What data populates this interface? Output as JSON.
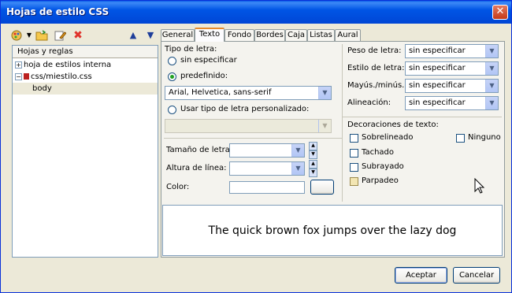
{
  "window": {
    "title": "Hojas de estilo CSS",
    "close": "✕"
  },
  "toolbar": {
    "move_up": "▲",
    "move_down": "▼"
  },
  "tree": {
    "header": "Hojas y reglas",
    "items": [
      {
        "label": "hoja de estilos interna",
        "expander": "+"
      },
      {
        "label": "css/miestilo.css",
        "expander": "−"
      },
      {
        "label": "body"
      }
    ]
  },
  "tabs": [
    "General",
    "Texto",
    "Fondo",
    "Bordes",
    "Caja",
    "Listas",
    "Aural"
  ],
  "font": {
    "section_label": "Tipo de letra:",
    "radio_unspecified": "sin especificar",
    "radio_predefined": "predefinido:",
    "predefined_value": "Arial, Helvetica, sans-serif",
    "radio_custom": "Usar tipo de letra personalizado:",
    "custom_value": ""
  },
  "size": {
    "size_label": "Tamaño de letra:",
    "size_value": "",
    "line_height_label": "Altura de línea:",
    "line_height_value": "",
    "color_label": "Color:",
    "color_value": ""
  },
  "props": {
    "weight_label": "Peso de letra:",
    "weight_value": "sin especificar",
    "style_label": "Estilo de letra:",
    "style_value": "sin especificar",
    "case_label": "Mayús./minús.:",
    "case_value": "sin especificar",
    "align_label": "Alineación:",
    "align_value": "sin especificar"
  },
  "decorations": {
    "label": "Decoraciones de texto:",
    "overline": "Sobrelineado",
    "none": "Ninguno",
    "strike": "Tachado",
    "underline": "Subrayado",
    "blink": "Parpadeo"
  },
  "preview": {
    "text": "The quick brown fox jumps over the lazy dog"
  },
  "buttons": {
    "accept": "Aceptar",
    "cancel": "Cancelar"
  },
  "colors": {
    "title_bar": "#0055e5",
    "tab_highlight": "#e68b2c",
    "radio_dot": "#21a121"
  }
}
